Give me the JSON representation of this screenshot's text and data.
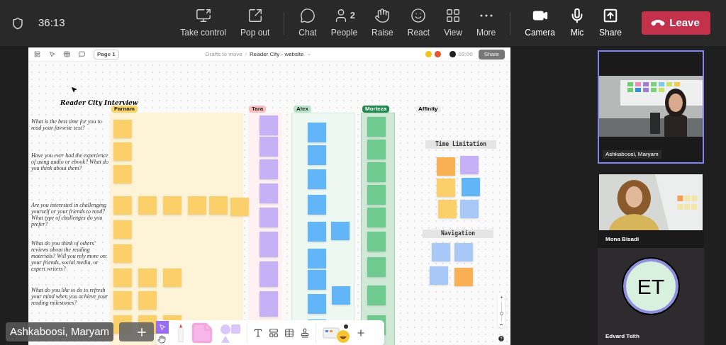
{
  "meeting": {
    "timer": "36:13",
    "controls": [
      {
        "label": "Take control"
      },
      {
        "label": "Pop out"
      },
      {
        "label": "Chat"
      },
      {
        "label": "People",
        "count": "2"
      },
      {
        "label": "Raise"
      },
      {
        "label": "React"
      },
      {
        "label": "View"
      },
      {
        "label": "More"
      },
      {
        "label": "Camera"
      },
      {
        "label": "Mic"
      },
      {
        "label": "Share"
      }
    ],
    "leave": "Leave"
  },
  "shared_board": {
    "page": "Page 1",
    "breadcrumb": [
      "Drafts to move",
      "Reader City - website"
    ],
    "separator": "/",
    "timer": "03:00",
    "share": "Share",
    "title": "Reader City Interview",
    "questions": [
      "What is the best time for you to read your favorite text?",
      "Have you ever had the experience of using audio or ebook? What do you think about them?",
      "Are you interested in challenging yourself or your friends to read? What type of challenges do you prefer?",
      "What do you think of others' reviews about the reading materials? Will you rely more on: your friends, social media, or expert writers?",
      "What do you like to do to refresh your mind when you achieve your reading milestones?"
    ],
    "columns": [
      {
        "label": "Farnam",
        "color": "#fbd463"
      },
      {
        "label": "Tara",
        "color": "#f9c0c0"
      },
      {
        "label": "Alex",
        "color": "#b9e6c9"
      },
      {
        "label": "Morteza",
        "color": "#1f8a4c"
      }
    ],
    "affinity": {
      "label": "Affinity",
      "groups": [
        "Time Limitation",
        "Navigation"
      ]
    },
    "zoom": {
      "level": 0.4
    }
  },
  "participants": [
    {
      "name": "Ashkaboosi, Maryam",
      "kind": "video",
      "selected": true
    },
    {
      "name": "Mona Bisadi",
      "kind": "video",
      "selected": false
    },
    {
      "name": "Edvard Teith",
      "kind": "avatar",
      "initials": "ET",
      "selected": false
    }
  ],
  "presenter": {
    "name": "Ashkaboosi, Maryam"
  }
}
